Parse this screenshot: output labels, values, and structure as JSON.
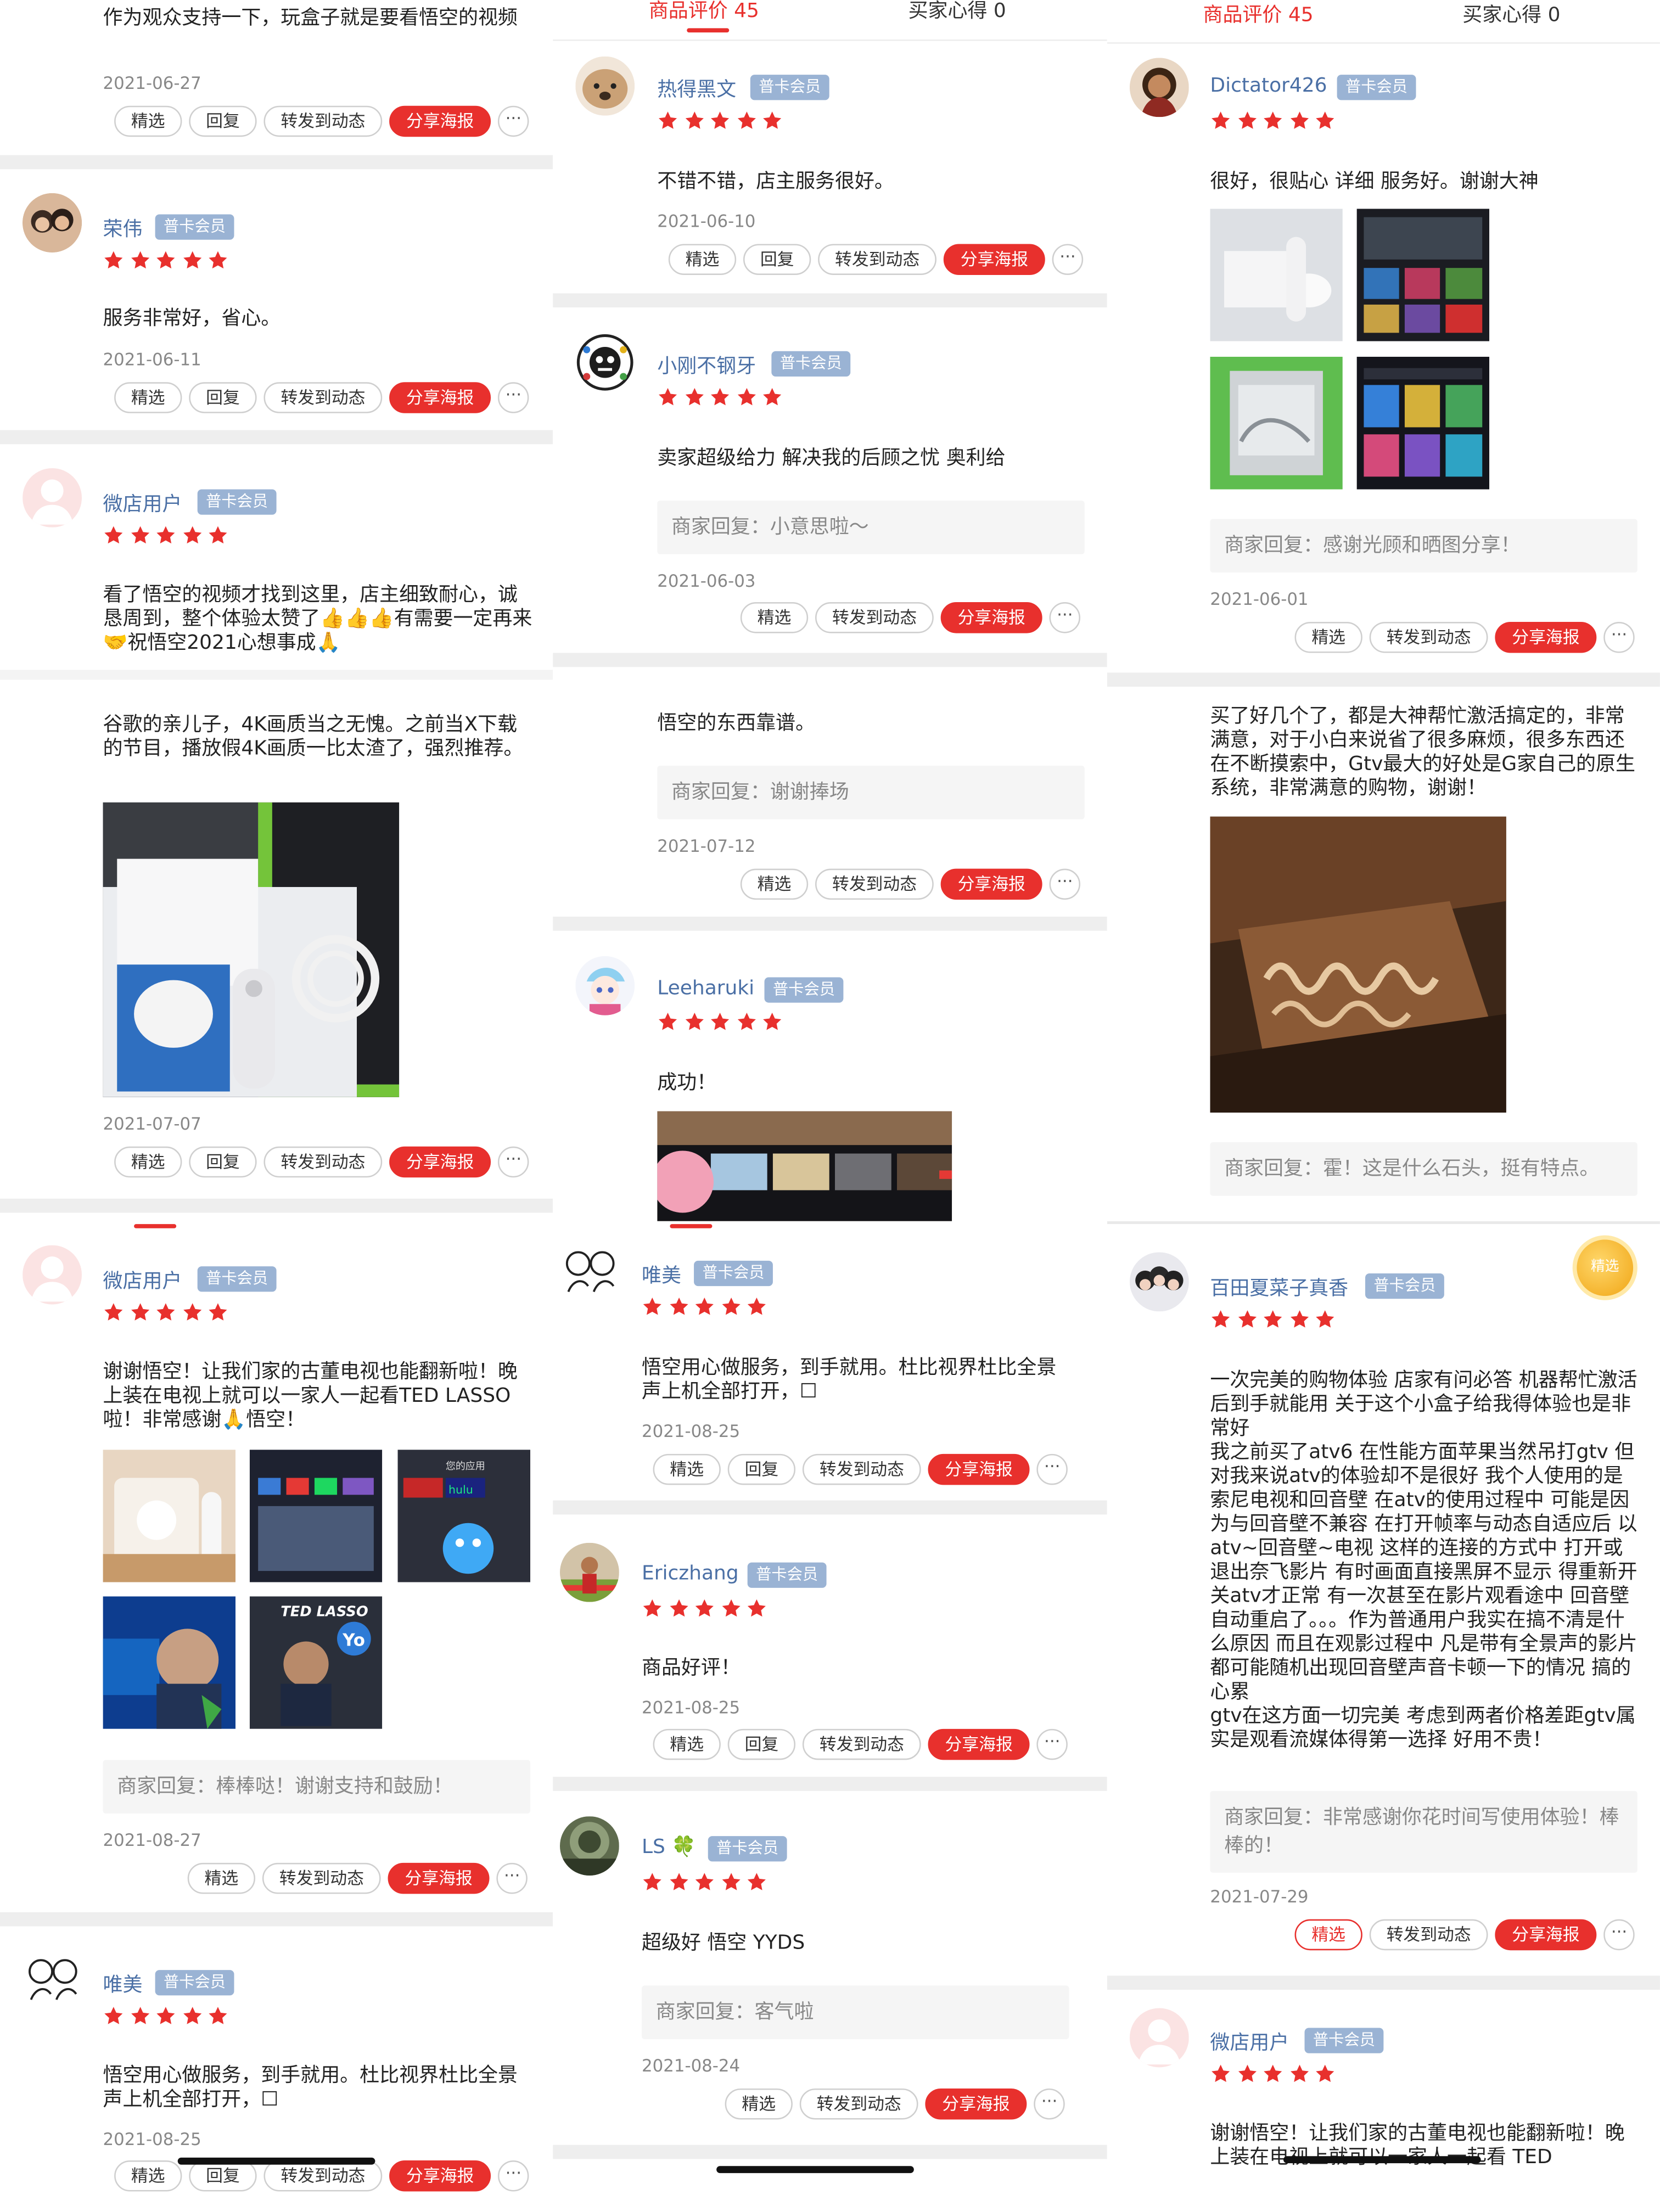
{
  "tabs": {
    "reviews": "商品评价 45",
    "tips": "买家心得 0",
    "tips_mid": "买家心得 0"
  },
  "buttons": {
    "select": "精选",
    "reply": "回复",
    "repost": "转发到动态",
    "share": "分享海报",
    "more": "···"
  },
  "badge": "普卡会员",
  "merchant_prefix": "商家回复：",
  "col1": {
    "r0": {
      "text": "作为观众支持一下，玩盒子就是要看悟空的视频",
      "date": "2021-06-27"
    },
    "r1": {
      "user": "荣伟",
      "text": "服务非常好，省心。",
      "date": "2021-06-11"
    },
    "r2": {
      "user": "微店用户",
      "text": "看了悟空的视频才找到这里，店主细致耐心，诚恳周到，整个体验太赞了👍👍👍有需要一定再来🤝祝悟空2021心想事成🙏",
      "text2": "谷歌的亲儿子，4K画质当之无愧。之前当X下载的节目，播放假4K画质一比太渣了，强烈推荐。",
      "date": "2021-07-07"
    },
    "r3": {
      "user": "微店用户",
      "text": "谢谢悟空！让我们家的古董电视也能翻新啦！晚上装在电视上就可以一家人一起看TED LASSO啦！非常感谢🙏悟空！",
      "reply": "商家回复：棒棒哒！谢谢支持和鼓励！",
      "date": "2021-08-27"
    },
    "r4": {
      "user": "唯美",
      "text": "悟空用心做服务，到手就用。杜比视界杜比全景声上机全部打开，☐",
      "date": "2021-08-25"
    }
  },
  "col2": {
    "r0": {
      "user": "热得黑文",
      "text": "不错不错，店主服务很好。",
      "date": "2021-06-10"
    },
    "r1": {
      "user": "小刚不钢牙",
      "text": "卖家超级给力  解决我的后顾之忧 奥利给",
      "reply": "商家回复：小意思啦～",
      "date": "2021-06-03"
    },
    "r2": {
      "text": "悟空的东西靠谱。",
      "reply": "商家回复：谢谢捧场",
      "date": "2021-07-12"
    },
    "r3": {
      "user": "Leeharuki",
      "text": "成功！"
    },
    "r4": {
      "user": "唯美",
      "text": "悟空用心做服务，到手就用。杜比视界杜比全景声上机全部打开，☐",
      "date": "2021-08-25"
    },
    "r5": {
      "user": "Ericzhang",
      "text": "商品好评！",
      "date": "2021-08-25"
    },
    "r6": {
      "user": "LS 🍀",
      "text": "超级好 悟空 YYDS",
      "reply": "商家回复：客气啦",
      "date": "2021-08-24"
    }
  },
  "col3": {
    "r0": {
      "user": "Dictator426",
      "text": "很好，很贴心 详细 服务好。谢谢大神",
      "reply": "商家回复：感谢光顾和晒图分享！",
      "date": "2021-06-01"
    },
    "r1": {
      "text": "买了好几个了，都是大神帮忙激活搞定的，非常满意，对于小白来说省了很多麻烦，很多东西还在不断摸索中，Gtv最大的好处是G家自己的原生系统，非常满意的购物，谢谢！",
      "reply": "商家回复：霍！这是什么石头，挺有特点。"
    },
    "r2": {
      "user": "百田夏菜子真香",
      "medal": "精选",
      "text": "一次完美的购物体验 店家有问必答 机器帮忙激活后到手就能用 关于这个小盒子给我得体验也是非常好\n我之前买了atv6 在性能方面苹果当然吊打gtv 但对我来说atv的体验却不是很好 我个人使用的是索尼电视和回音壁 在atv的使用过程中 可能是因为与回音壁不兼容 在打开帧率与动态自适应后 以atv~回音壁~电视 这样的连接的方式中 打开或退出奈飞影片 有时画面直接黑屏不显示 得重新开关atv才正常 有一次甚至在影片观看途中 回音壁自动重启了。。。作为普通用户我实在搞不清是什么原因 而且在观影过程中 凡是带有全景声的影片 都可能随机出现回音壁声音卡顿一下的情况 搞的心累\ngtv在这方面一切完美 考虑到两者价格差距gtv属实是观看流媒体得第一选择 好用不贵！",
      "reply": "商家回复：非常感谢你花时间写使用体验！棒棒的！",
      "date": "2021-07-29"
    },
    "r3": {
      "user": "微店用户",
      "text": "谢谢悟空！让我们家的古董电视也能翻新啦！晚上装在电视上就可以一家人一起看 TED"
    }
  },
  "images": {
    "ted": "TED LASSO",
    "yo": "Yo",
    "apps": "您的应用",
    "hulu": "hulu"
  },
  "colors": {
    "accent": "#e8302d",
    "username": "#4a6fa5",
    "badge": "#9ab3d4",
    "star": "#e8302d"
  }
}
